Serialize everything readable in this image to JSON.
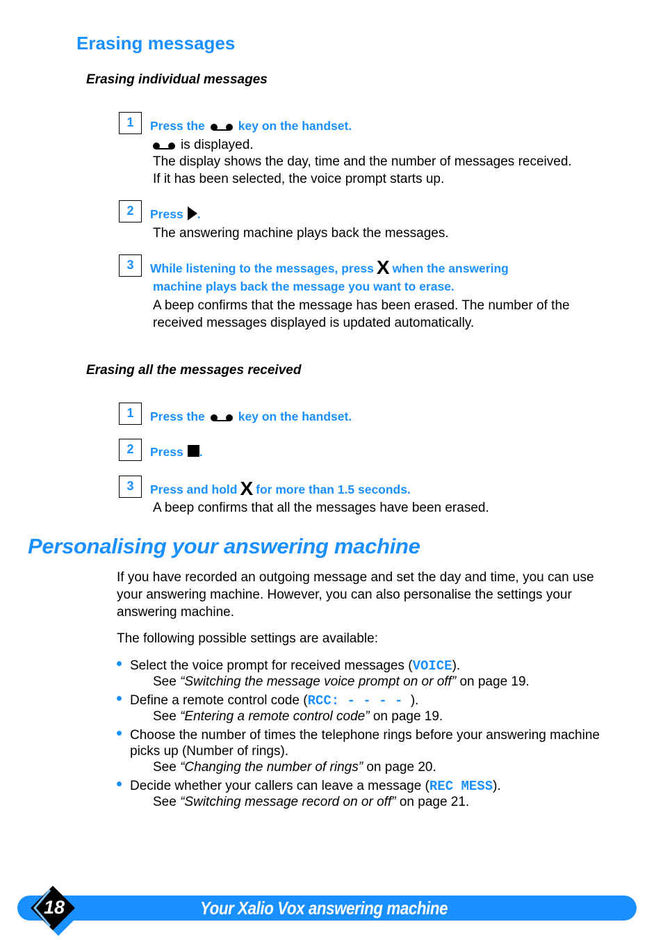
{
  "section1": {
    "title": "Erasing messages",
    "sub1": {
      "title": "Erasing individual messages",
      "steps": [
        {
          "number": "1",
          "title_before": "Press the",
          "icon": "answering-machine-tape-icon",
          "title_after": "key on the handset.",
          "lines": [
            "is displayed.",
            "The display shows the day, time and the number of messages received.",
            " If it has been selected, the voice prompt starts up."
          ]
        },
        {
          "number": "2",
          "title_before": "Press",
          "icon": "play-icon",
          "title_after": ".",
          "lines": [
            "The answering machine plays back the messages."
          ]
        },
        {
          "number": "3",
          "title_before": "While listening to the messages, press",
          "icon": "erase-x-icon",
          "title_after": "when the answering",
          "title_line2": "machine plays back the message you want to erase.",
          "lines": [
            "A beep confirms that the message has been erased.  The number of the",
            "received messages displayed is updated automatically."
          ]
        }
      ]
    },
    "sub2": {
      "title": "Erasing all the messages received",
      "steps": [
        {
          "number": "1",
          "title_before": "Press the",
          "icon": "answering-machine-tape-icon",
          "title_after": "key on the handset."
        },
        {
          "number": "2",
          "title_before": "Press",
          "icon": "stop-icon",
          "title_after": "."
        },
        {
          "number": "3",
          "title_before": "Press and hold",
          "icon": "erase-x-icon",
          "title_after": "for more than 1.5 seconds.",
          "lines": [
            "A beep confirms that all the messages have been erased."
          ]
        }
      ]
    }
  },
  "section2": {
    "title": "Personalising your answering machine",
    "intro": [
      "If you have recorded an outgoing message and set the day and time, you can use",
      "your answering machine.  However, you can also personalise the settings your",
      "answering machine."
    ],
    "lead": "The following possible settings are available:",
    "bullets": [
      {
        "text_before": "Select the voice prompt for received messages (",
        "code": "VOICE",
        "text_after": ").",
        "see": "See ",
        "ref": "“Switching the message voice prompt on or off”",
        "page": " on page 19."
      },
      {
        "text_before": "Define a remote control code (",
        "code": "RCC: - - - - ",
        "text_after": ").",
        "see": "See ",
        "ref": "“Entering a remote control code”",
        "page": " on page 19."
      },
      {
        "text_before": "Choose the number of times the telephone rings before your answering machine",
        "line2": "picks up (Number of rings).",
        "see": "See ",
        "ref": "“Changing the number of rings”",
        "page": " on page 20."
      },
      {
        "text_before": "Decide whether your callers can leave a message (",
        "code": "REC MESS",
        "text_after": ").",
        "see": "See ",
        "ref": "“Switching message record on or off”",
        "page": " on page 21."
      }
    ]
  },
  "footer": {
    "page_number": "18",
    "title": "Your Xalio Vox answering machine",
    "accent": "#1a90ff"
  }
}
